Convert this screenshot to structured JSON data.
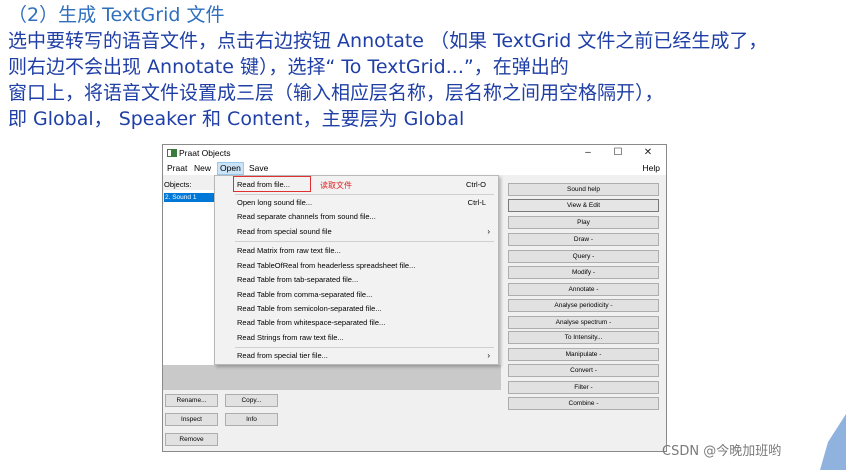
{
  "instructions": {
    "line1": "（2）生成  TextGrid 文件",
    "line2": "选中要转写的语音文件，点击右边按钮 Annotate （如果 TextGrid 文件之前已经生成了，",
    "line3": "则右边不会出现 Annotate 键），选择“ To TextGrid...”，在弹出的",
    "line4": "窗口上，将语音文件设置成三层（输入相应层名称，层名称之间用空格隔开），",
    "line5": "即 Global，  Speaker 和 Content，主要层为 Global"
  },
  "window": {
    "title": "Praat Objects",
    "minimize": "–",
    "maximize": "☐",
    "close": "✕",
    "menus": [
      "Praat",
      "New",
      "Open",
      "Save"
    ],
    "help": "Help",
    "objects_label": "Objects:",
    "selected_object": "2. Sound 1",
    "left_buttons": [
      "Rename...",
      "Copy...",
      "Inspect",
      "Info",
      "Remove"
    ],
    "right_buttons": [
      "Sound help",
      "View & Edit",
      "Play",
      "Draw -",
      "Query -",
      "Modify -",
      "Annotate -",
      "Analyse periodicity -",
      "Analyse spectrum -",
      "To Intensity...",
      "Manipulate -",
      "Convert -",
      "Filter -",
      "Combine -"
    ]
  },
  "open_menu": {
    "items": [
      {
        "label": "Read from file...",
        "shortcut": "Ctrl-O"
      },
      {
        "label": "Open long sound file...",
        "shortcut": "Ctrl-L"
      },
      {
        "label": "Read separate channels from sound file...",
        "shortcut": ""
      },
      {
        "label": "Read from special sound file",
        "shortcut": "",
        "submenu": "›"
      },
      {
        "label": "Read Matrix from raw text file...",
        "shortcut": ""
      },
      {
        "label": "Read TableOfReal from headerless spreadsheet file...",
        "shortcut": ""
      },
      {
        "label": "Read Table from tab-separated file...",
        "shortcut": ""
      },
      {
        "label": "Read Table from comma-separated file...",
        "shortcut": ""
      },
      {
        "label": "Read Table from semicolon-separated file...",
        "shortcut": ""
      },
      {
        "label": "Read Table from whitespace-separated file...",
        "shortcut": ""
      },
      {
        "label": "Read Strings from raw text file...",
        "shortcut": ""
      },
      {
        "label": "Read from special tier file...",
        "shortcut": "",
        "submenu": "›"
      }
    ],
    "annotation": "读取文件"
  },
  "watermark": "CSDN @今晚加班哟",
  "colors": {
    "instruction_text": "#1f3fa6",
    "highlight_box": "#e03030",
    "selection": "#0078d7"
  }
}
